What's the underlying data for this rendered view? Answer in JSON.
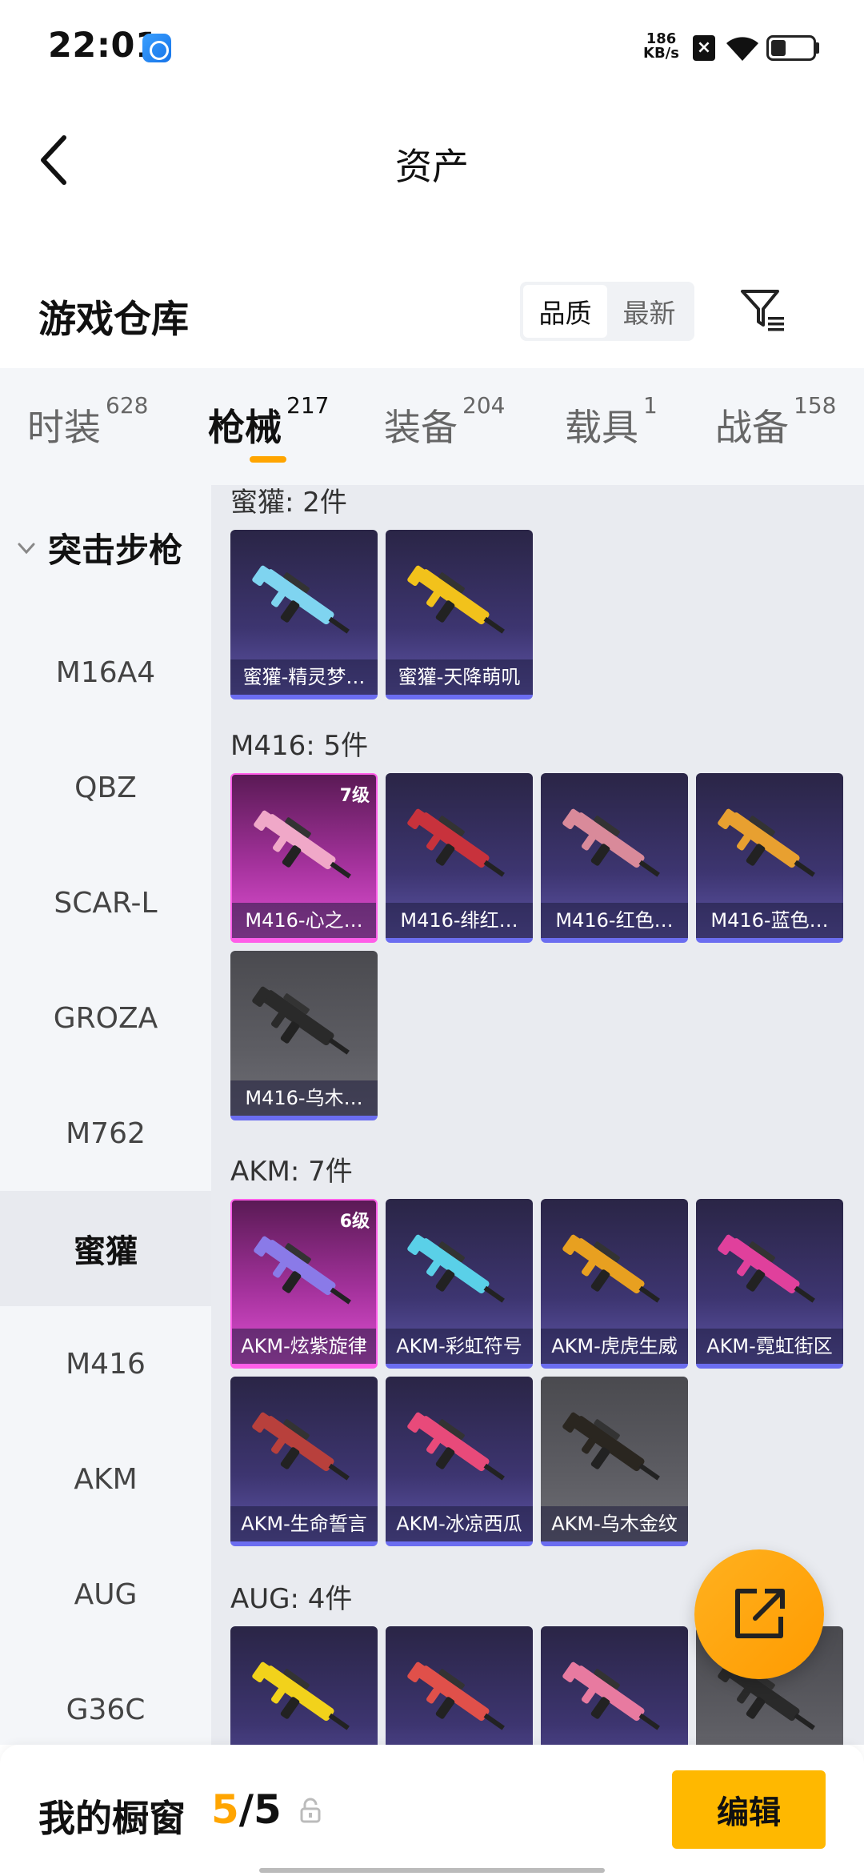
{
  "status_bar": {
    "time": "22:01",
    "speed_value": "186",
    "speed_unit": "KB/s",
    "battery_level": 0.35
  },
  "nav": {
    "title": "资产"
  },
  "warehouse": {
    "title": "游戏仓库",
    "sort_quality": "品质",
    "sort_newest": "最新"
  },
  "tabs": [
    {
      "label": "时装",
      "count": "628"
    },
    {
      "label": "枪械",
      "count": "217"
    },
    {
      "label": "装备",
      "count": "204"
    },
    {
      "label": "载具",
      "count": "1"
    },
    {
      "label": "战备",
      "count": "158"
    }
  ],
  "sidebar": {
    "group": "突击步枪",
    "items": [
      "M16A4",
      "QBZ",
      "SCAR-L",
      "GROZA",
      "M762",
      "蜜獾",
      "M416",
      "AKM",
      "AUG",
      "G36C"
    ],
    "active": "蜜獾"
  },
  "groups": [
    {
      "title": "蜜獾: 2件",
      "items": [
        {
          "label": "蜜獾-精灵梦…",
          "style": "purple",
          "color": "#7fd4f0"
        },
        {
          "label": "蜜獾-天降萌叽",
          "style": "purple",
          "color": "#f2c21b"
        }
      ]
    },
    {
      "title": "M416: 5件",
      "items": [
        {
          "label": "M416-心之…",
          "style": "pink",
          "level": "7级",
          "color": "#f0a8c8"
        },
        {
          "label": "M416-绯红…",
          "style": "purple",
          "color": "#c8323c"
        },
        {
          "label": "M416-红色…",
          "style": "purple",
          "color": "#d98a9a"
        },
        {
          "label": "M416-蓝色…",
          "style": "purple",
          "color": "#e8a030"
        },
        {
          "label": "M416-乌木…",
          "style": "grey",
          "color": "#2a2a2a"
        }
      ]
    },
    {
      "title": "AKM: 7件",
      "items": [
        {
          "label": "AKM-炫紫旋律",
          "style": "pink",
          "level": "6级",
          "color": "#8a7ae8"
        },
        {
          "label": "AKM-彩虹符号",
          "style": "purple",
          "color": "#5ad0e8"
        },
        {
          "label": "AKM-虎虎生威",
          "style": "purple",
          "color": "#e8a020"
        },
        {
          "label": "AKM-霓虹街区",
          "style": "purple",
          "color": "#e0409c"
        },
        {
          "label": "AKM-生命誓言",
          "style": "purple",
          "color": "#b8403c"
        },
        {
          "label": "AKM-冰凉西瓜",
          "style": "purple",
          "color": "#e84a7a"
        },
        {
          "label": "AKM-乌木金纹",
          "style": "grey",
          "color": "#2a2620"
        }
      ]
    },
    {
      "title": "AUG: 4件",
      "items": [
        {
          "label": "",
          "style": "purple",
          "color": "#f2d21b"
        },
        {
          "label": "",
          "style": "purple",
          "color": "#e0504a"
        },
        {
          "label": "",
          "style": "purple",
          "color": "#e87aa0"
        },
        {
          "label": "",
          "style": "grey",
          "color": "#2a2a2a"
        }
      ]
    }
  ],
  "bottom": {
    "label": "我的橱窗",
    "current": "5",
    "total": "/5",
    "edit": "编辑"
  },
  "colors": {
    "accent": "#ffa500",
    "edit_button": "#ffb800"
  }
}
